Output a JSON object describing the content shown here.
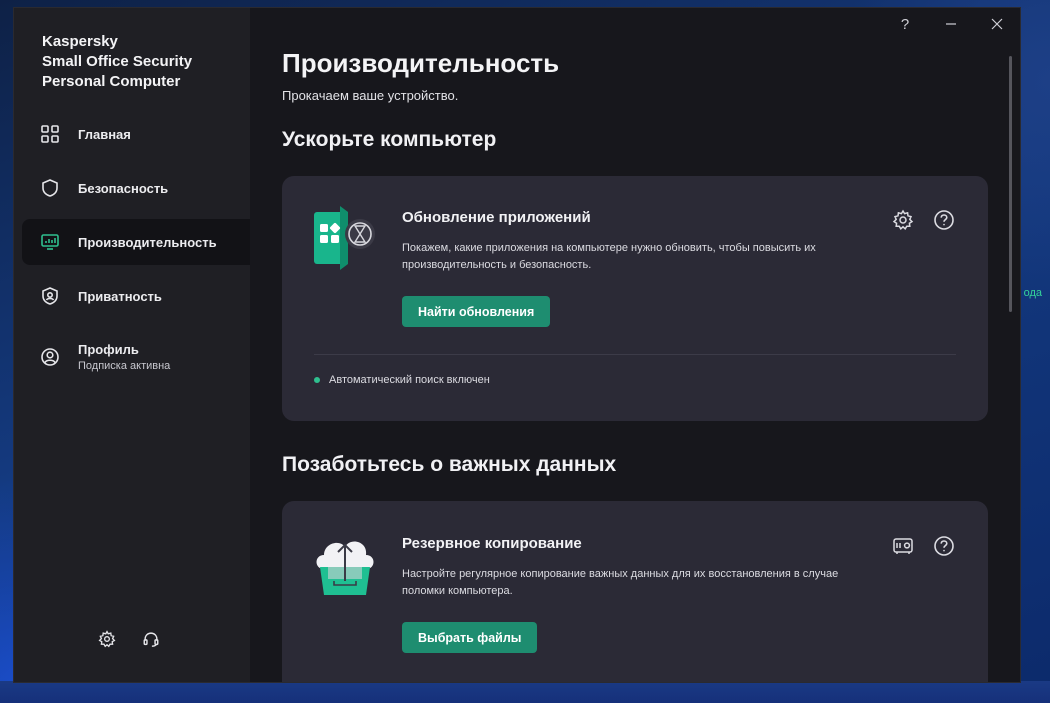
{
  "desktop": {
    "label": "ода"
  },
  "app": {
    "brand_line1": "Kaspersky",
    "brand_line2": "Small Office Security",
    "brand_line3": "Personal Computer"
  },
  "sidebar": {
    "items": [
      {
        "label": "Главная",
        "icon": "home-grid-icon"
      },
      {
        "label": "Безопасность",
        "icon": "shield-icon"
      },
      {
        "label": "Производительность",
        "icon": "monitor-icon",
        "active": true
      },
      {
        "label": "Приватность",
        "icon": "privacy-shield-icon"
      },
      {
        "label": "Профиль",
        "sublabel": "Подписка активна",
        "icon": "profile-icon"
      }
    ],
    "bottom": [
      "gear-icon",
      "headset-icon"
    ]
  },
  "window_controls": {
    "help": "?"
  },
  "page": {
    "title": "Производительность",
    "subtitle": "Прокачаем ваше устройство."
  },
  "sections": [
    {
      "title": "Ускорьте компьютер",
      "card": {
        "title": "Обновление приложений",
        "description": "Покажем, какие приложения на компьютере нужно обновить, чтобы повысить их производительность и безопасность.",
        "button": "Найти обновления",
        "status": "Автоматический поиск включен"
      }
    },
    {
      "title": "Позаботьтесь о важных данных",
      "card": {
        "title": "Резервное копирование",
        "description": "Настройте регулярное копирование важных данных для их восстановления в случае поломки компьютера.",
        "button": "Выбрать файлы"
      }
    }
  ],
  "colors": {
    "accent": "#1e8d70",
    "sidebar_bg": "#1f1f24",
    "main_bg": "#17171c",
    "card_bg": "#2b2a36",
    "status_on": "#2fbf8f"
  }
}
